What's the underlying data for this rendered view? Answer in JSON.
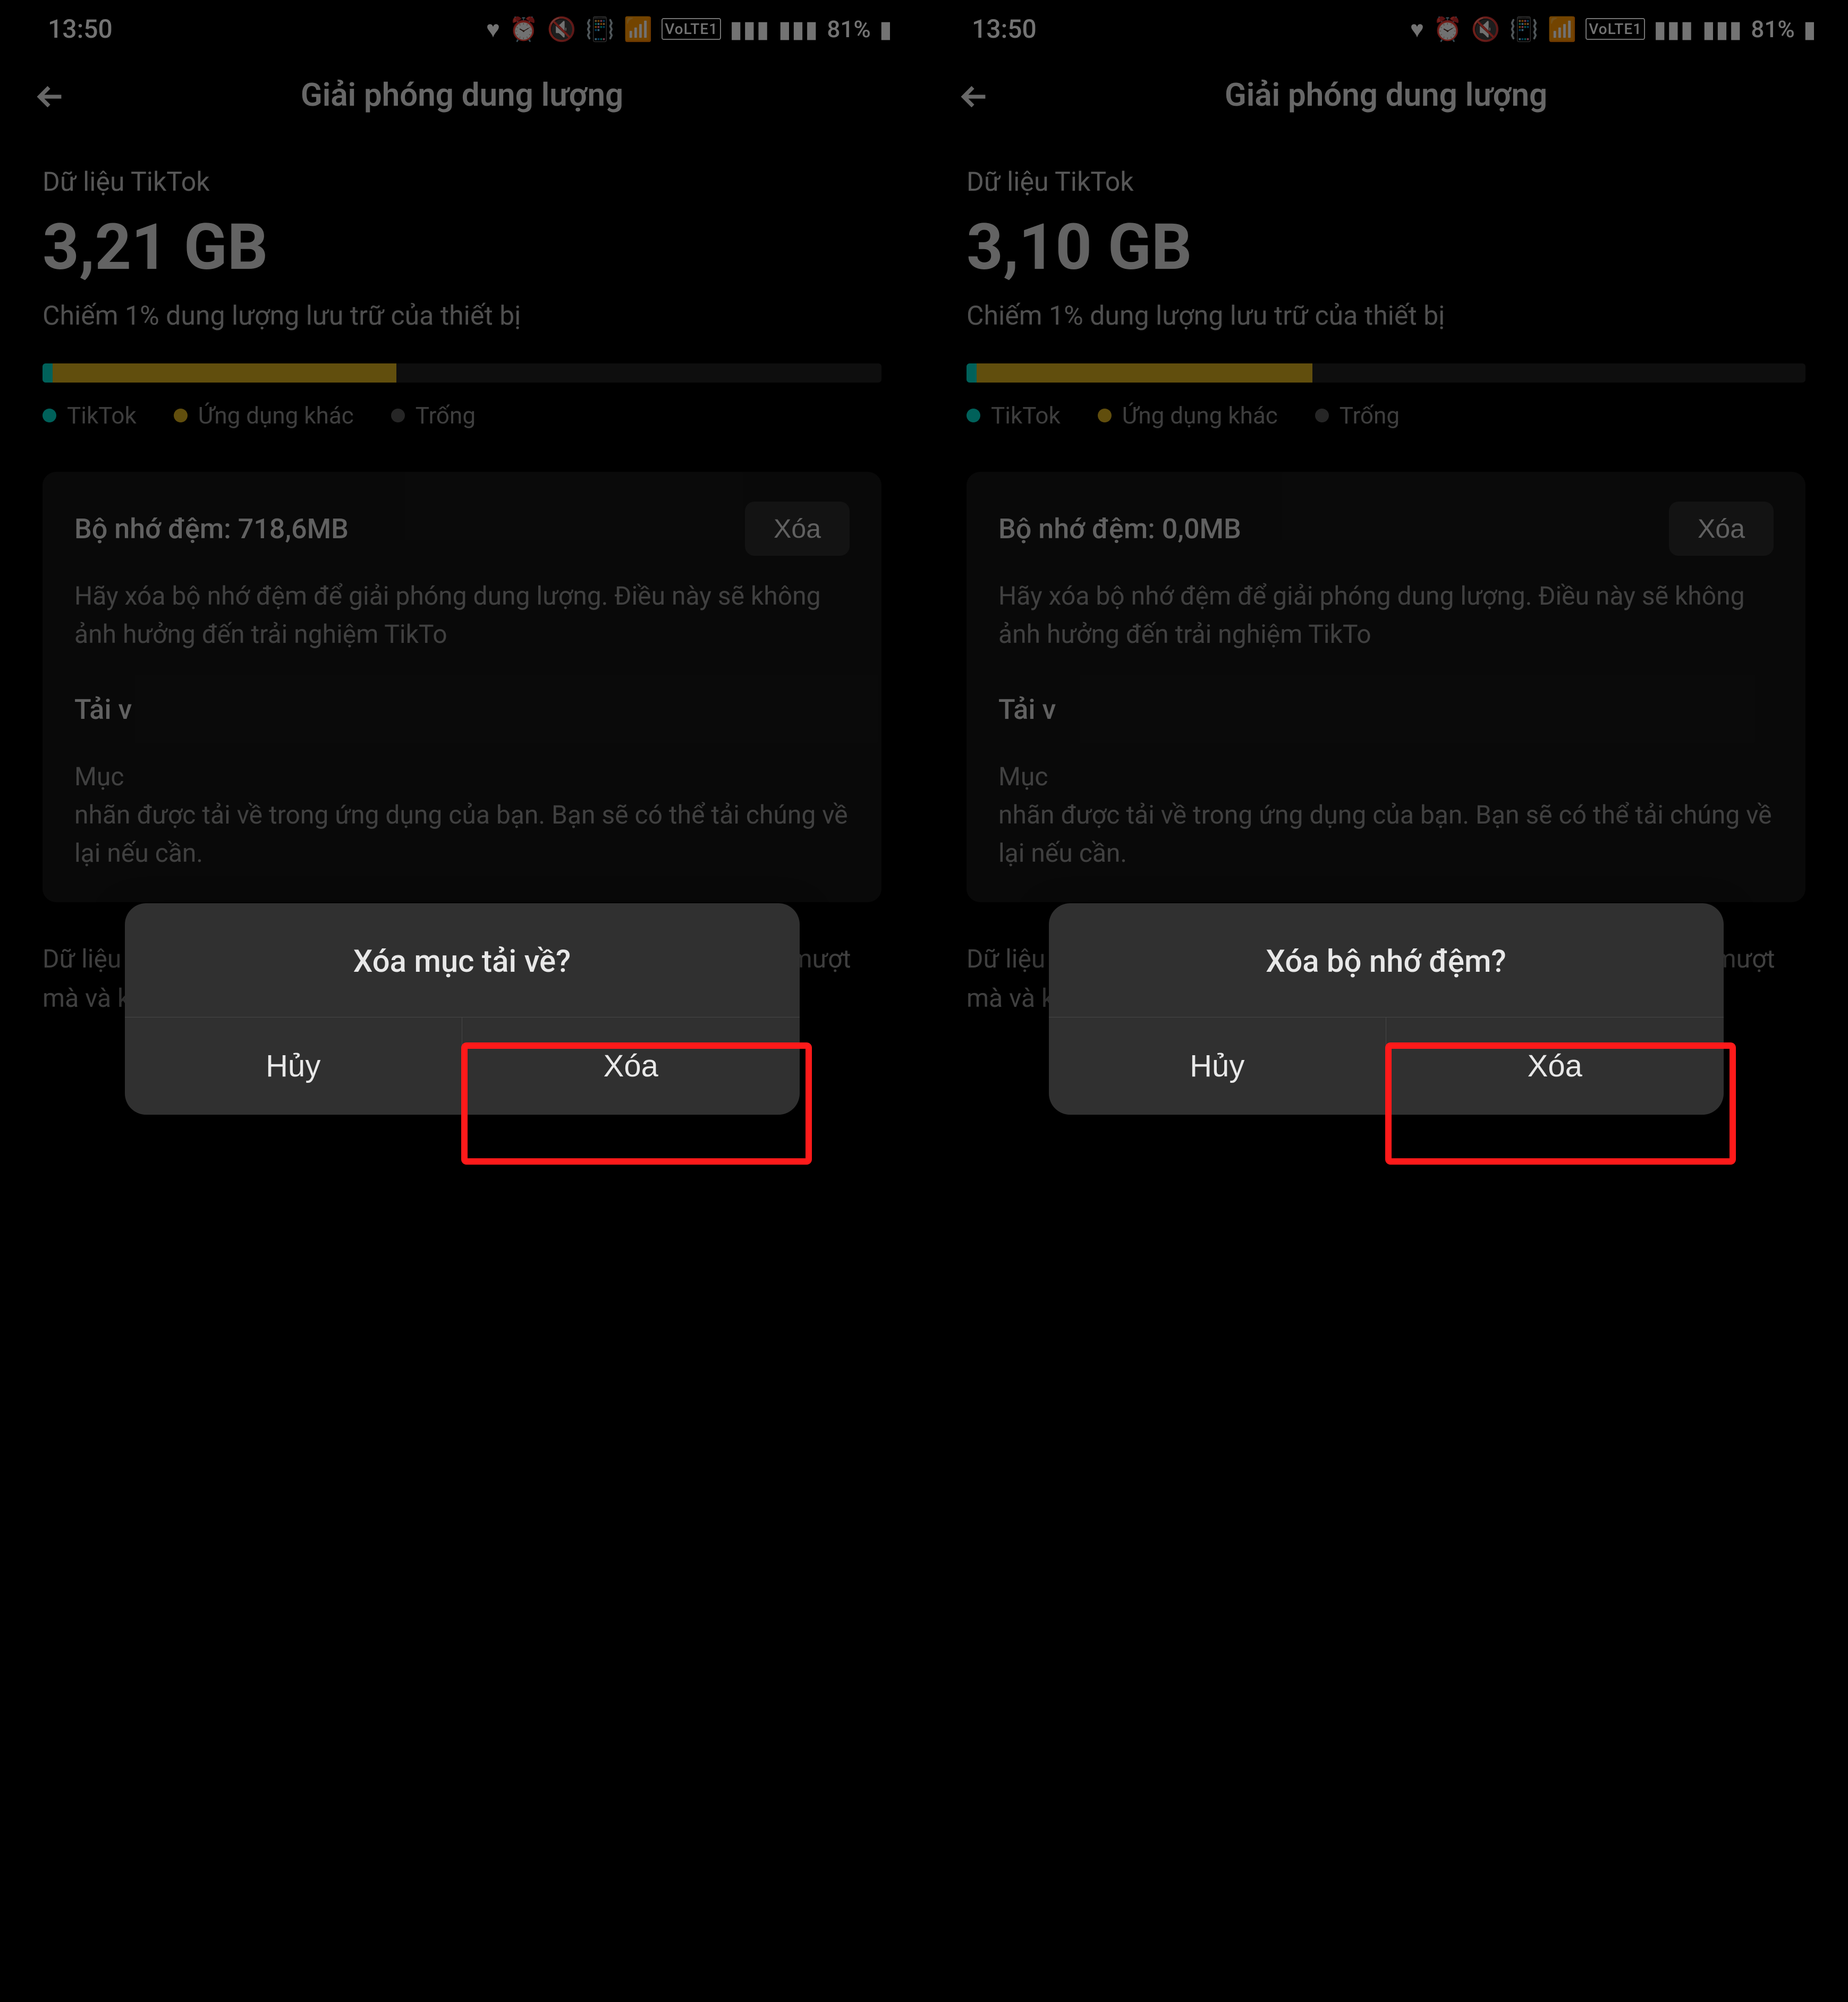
{
  "status": {
    "time": "13:50",
    "battery": "81%",
    "icons_text": "♥ ⏰ 🔇 📳 📶 VoLTE1 📶 📶"
  },
  "header": {
    "title": "Giải phóng dung lượng"
  },
  "left": {
    "data_label": "Dữ liệu TikTok",
    "size": "3,21 GB",
    "storage_note": "Chiếm 1% dung lượng lưu trữ của thiết bị",
    "bar_teal_pct": 1.2,
    "bar_yellow_pct": 41,
    "cache_label": "Bộ nhớ đệm: 718,6MB",
    "download_label": "Tải v",
    "dialog_title": "Xóa mục tải về?"
  },
  "right": {
    "data_label": "Dữ liệu TikTok",
    "size": "3,10 GB",
    "storage_note": "Chiếm 1% dung lượng lưu trữ của thiết bị",
    "bar_teal_pct": 1.2,
    "bar_yellow_pct": 40,
    "cache_label": "Bộ nhớ đệm: 0,0MB",
    "download_label": "Tải v",
    "dialog_title": "Xóa bộ nhớ đệm?"
  },
  "common": {
    "legend_tiktok": "TikTok",
    "legend_other": "Ứng dụng khác",
    "legend_free": "Trống",
    "delete_label": "Xóa",
    "cache_desc": "Hãy xóa bộ nhớ đệm để giải phóng dung lượng. Điều này sẽ không ảnh hưởng đến trải nghiệm TikTo",
    "download_desc_start": "Mục",
    "download_desc_rest": "nhãn                                                                  được tải về trong ứng dụng của bạn. Bạn sẽ có thể tải chúng về lại nếu cần.",
    "footer_note": "Dữ liệu TikTok cũng bao gồm tập tin hệ thống giúp ứng dụng chạy mượt mà và không thể xóa.",
    "cancel_label": "Hủy"
  }
}
